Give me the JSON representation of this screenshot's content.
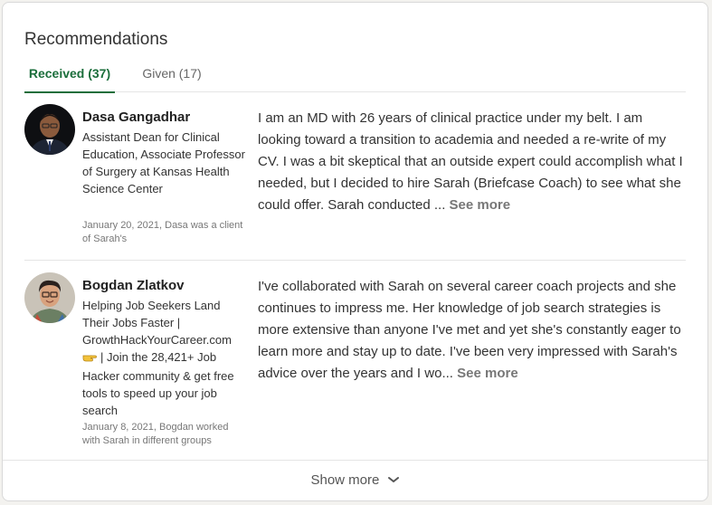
{
  "section": {
    "title": "Recommendations",
    "tabs": [
      {
        "label": "Received (37)",
        "active": true
      },
      {
        "label": "Given (17)",
        "active": false
      }
    ]
  },
  "recommendations": [
    {
      "name": "Dasa Gangadhar",
      "headline": "Assistant Dean for Clinical Education, Associate Professor of Surgery at Kansas Health Science Center",
      "meta": "January 20, 2021, Dasa was a client of Sarah's",
      "text": "I am an MD with 26 years of clinical practice under my belt. I am looking toward a transition to academia and needed a re-write of my CV. I was a bit skeptical that an outside expert could accomplish what I needed, but I decided to hire Sarah (Briefcase Coach) to see what she could offer. Sarah conducted ...",
      "see_more": "See more"
    },
    {
      "name": "Bogdan Zlatkov",
      "headline_part1": "Helping Job Seekers Land Their Jobs Faster | GrowthHackYourCareer.com",
      "headline_part2": "| Join the 28,421+ Job Hacker community & get free tools to speed up your job search",
      "meta": "January 8, 2021, Bogdan worked with Sarah in different groups",
      "text": "I've collaborated with Sarah on several career coach projects and she continues to impress me. Her knowledge of job search strategies is more extensive than anyone I've met and yet she's constantly eager to learn more and stay up to date. I've been very impressed with Sarah's advice over the years and I wo...",
      "see_more": "See more"
    }
  ],
  "footer": {
    "show_more": "Show more"
  },
  "colors": {
    "accent": "#1b6e3b",
    "muted": "#777777"
  },
  "icons": [
    "pointing-hand-icon",
    "chevron-down-icon"
  ]
}
